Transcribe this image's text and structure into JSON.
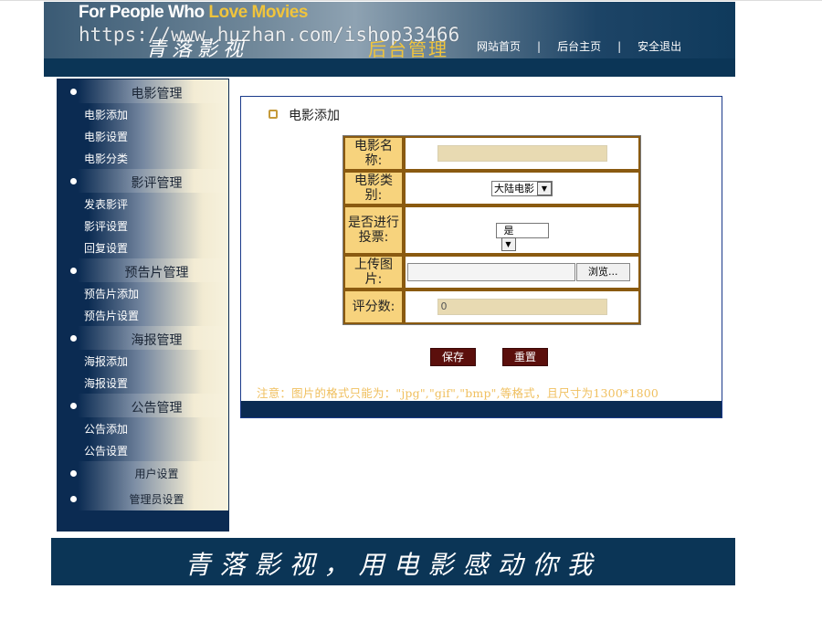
{
  "header": {
    "slogan_part1": "For People Who ",
    "slogan_part2": "Love Movies",
    "brand": "青落影视",
    "backend_title": "后台管理",
    "watermark": "https://www.huzhan.com/ishop33466",
    "nav": [
      {
        "label": "网站首页"
      },
      {
        "label": "后台主页"
      },
      {
        "label": "安全退出"
      }
    ],
    "nav_separator": "|"
  },
  "sidebar": {
    "groups": [
      {
        "title": "电影管理",
        "items": [
          "电影添加",
          "电影设置",
          "电影分类"
        ]
      },
      {
        "title": "影评管理",
        "items": [
          "发表影评",
          "影评设置",
          "回复设置"
        ]
      },
      {
        "title": "预告片管理",
        "items": [
          "预告片添加",
          "预告片设置"
        ]
      },
      {
        "title": "海报管理",
        "items": [
          "海报添加",
          "海报设置"
        ]
      },
      {
        "title": "公告管理",
        "items": [
          "公告添加",
          "公告设置"
        ]
      },
      {
        "title": "用户设置",
        "items": []
      },
      {
        "title": "管理员设置",
        "items": []
      }
    ]
  },
  "main": {
    "title": "电影添加",
    "form": {
      "name_label": "电影名称:",
      "name_value": "",
      "category_label": "电影类别:",
      "category_selected": "大陆电影",
      "vote_label": "是否进行投票:",
      "vote_selected": "是",
      "upload_label": "上传图片:",
      "browse_label": "浏览...",
      "score_label": "评分数:",
      "score_value": "0"
    },
    "save_label": "保存",
    "reset_label": "重置",
    "note": "注意：图片的格式只能为：\"jpg\",\"gif\",\"bmp\",等格式，且尺寸为1300*1800"
  },
  "footer": {
    "slogan": "青落影视，用电影感动你我"
  },
  "colors": {
    "navy": "#0b3556",
    "label_bg": "#f7d37d",
    "button_bg": "#5b0f0c",
    "note": "#f0c060"
  }
}
